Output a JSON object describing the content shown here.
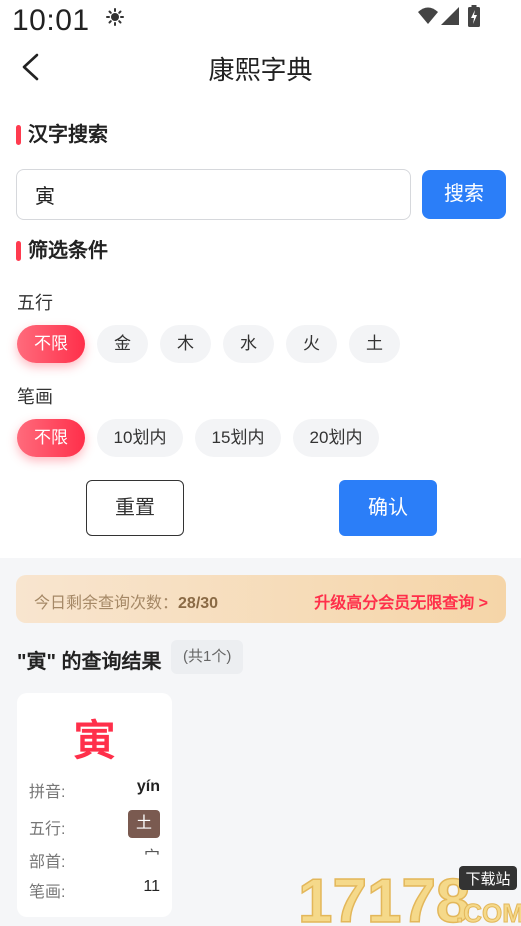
{
  "status_bar": {
    "time": "10:01"
  },
  "header": {
    "title": "康熙字典"
  },
  "search_section": {
    "title": "汉字搜索",
    "input_value": "寅",
    "button_label": "搜索"
  },
  "filter_section": {
    "title": "筛选条件",
    "wuxing": {
      "label": "五行",
      "options": [
        "不限",
        "金",
        "木",
        "水",
        "火",
        "土"
      ],
      "selected": "不限"
    },
    "strokes": {
      "label": "笔画",
      "options": [
        "不限",
        "10划内",
        "15划内",
        "20划内"
      ],
      "selected": "不限"
    },
    "reset_label": "重置",
    "confirm_label": "确认"
  },
  "quota": {
    "text": "今日剩余查询次数：",
    "count": "28/30",
    "upgrade_label": "升级高分会员无限查询 >"
  },
  "results": {
    "title": "\"寅\" 的查询结果",
    "count_label": "(共1个)",
    "items": [
      {
        "char": "寅",
        "pinyin_key": "拼音:",
        "pinyin": "yín",
        "wuxing_key": "五行:",
        "wuxing": "土",
        "radical_key": "部首:",
        "radical": "宀",
        "strokes_key": "笔画:",
        "strokes": "11"
      }
    ]
  },
  "watermark": {
    "text": "17178",
    "badge": "下载站",
    "domain": ".COM"
  },
  "colors": {
    "accent_red": "#ff2f4a",
    "primary_blue": "#2b7ef8",
    "wuxing_tag": "#7a5a50"
  }
}
